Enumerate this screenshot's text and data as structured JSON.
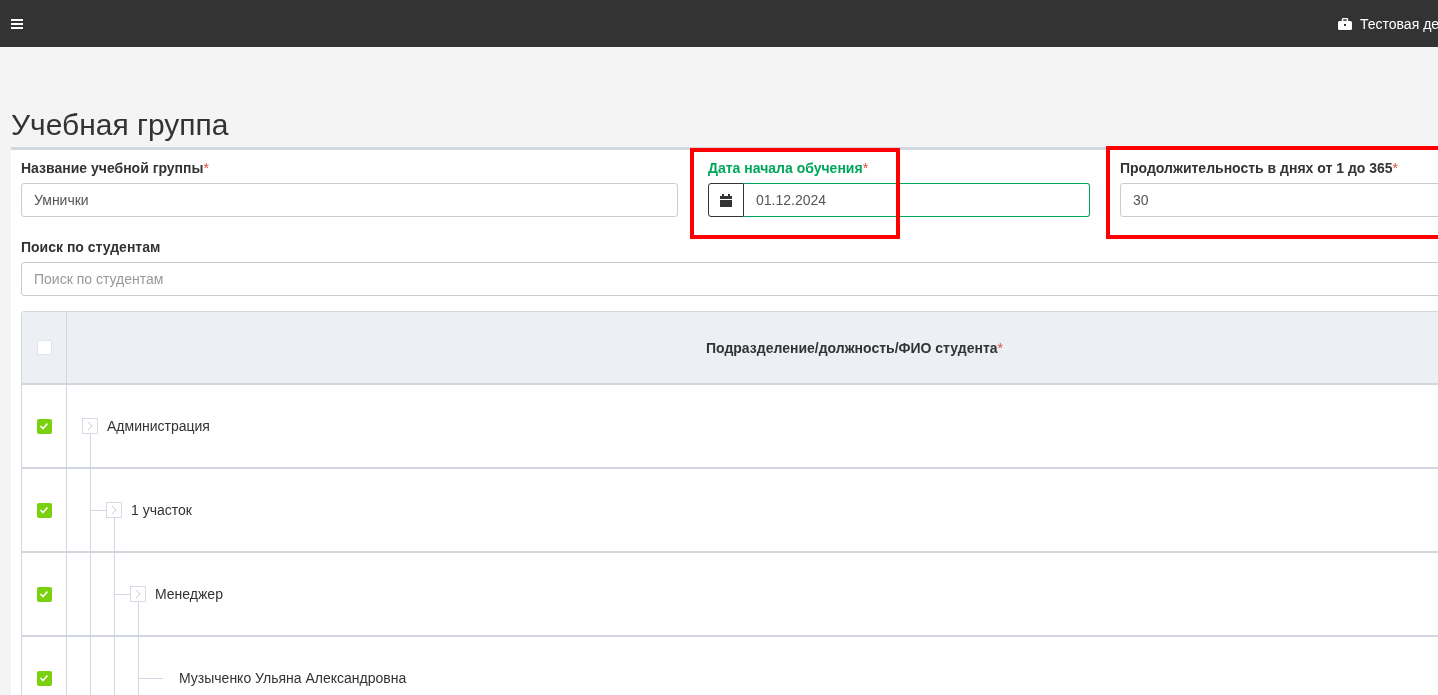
{
  "topbar": {
    "company": "Тестовая де"
  },
  "page_title": "Учебная группа",
  "fields": [
    {
      "kind": "text",
      "label": "Название учебной группы",
      "required_mark": "*",
      "value": "Умнички",
      "valid": false
    },
    {
      "kind": "date",
      "label": "Дата начала обучения",
      "required_mark": "*",
      "value": "01.12.2024",
      "valid": true,
      "highlighted": true
    },
    {
      "kind": "text",
      "label": "Продолжительность в днях от 1 до 365",
      "required_mark": "*",
      "value": "30",
      "valid": false,
      "highlighted": true
    }
  ],
  "search": {
    "label": "Поиск по студентам",
    "placeholder": "Поиск по студентам"
  },
  "table": {
    "select_all_checked": false,
    "column": "Подразделение/должность/ФИО студента",
    "column_required_mark": "*",
    "tree": [
      {
        "label": "Администрация",
        "checked": true,
        "children": [
          {
            "label": "1 участок",
            "checked": true,
            "children": [
              {
                "label": "Менеджер",
                "checked": true,
                "children": [
                  {
                    "label": "Музыченко Ульяна Александровна",
                    "checked": true
                  }
                ]
              }
            ]
          }
        ]
      }
    ]
  }
}
